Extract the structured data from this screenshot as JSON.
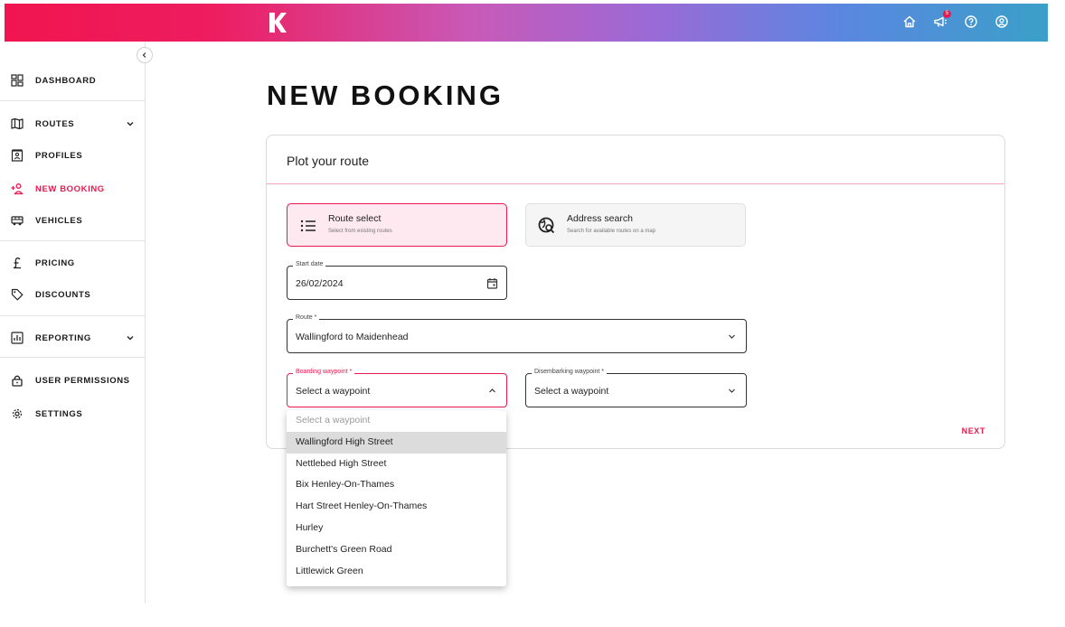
{
  "header": {
    "logo_letter": "K",
    "icons": [
      "home-icon",
      "megaphone-icon",
      "help-icon",
      "account-icon"
    ],
    "notification_count": "5"
  },
  "sidebar": {
    "items": [
      {
        "label": "DASHBOARD",
        "icon": "dashboard-icon"
      },
      {
        "label": "ROUTES",
        "icon": "map-icon"
      },
      {
        "label": "PROFILES",
        "icon": "profile-card-icon"
      },
      {
        "label": "NEW BOOKING",
        "icon": "add-person-icon",
        "active": true
      },
      {
        "label": "VEHICLES",
        "icon": "bus-icon"
      },
      {
        "label": "PRICING",
        "icon": "pound-icon"
      },
      {
        "label": "DISCOUNTS",
        "icon": "tag-icon"
      },
      {
        "label": "REPORTING",
        "icon": "report-icon"
      },
      {
        "label": "USER PERMISSIONS",
        "icon": "lock-icon"
      },
      {
        "label": "SETTINGS",
        "icon": "gear-icon"
      }
    ]
  },
  "page": {
    "title": "NEW BOOKING"
  },
  "card": {
    "title": "Plot your route",
    "options": [
      {
        "title": "Route select",
        "subtitle": "Select from existing routes",
        "selected": true
      },
      {
        "title": "Address search",
        "subtitle": "Search for available routes on a map",
        "selected": false
      }
    ],
    "start_date": {
      "label": "Start date",
      "value": "26/02/2024"
    },
    "route": {
      "label": "Route *",
      "value": "Wallingford to Maidenhead"
    },
    "boarding": {
      "label": "Boarding waypoint *",
      "value": "Select a waypoint"
    },
    "disembarking": {
      "label": "Disembarking waypoint *",
      "value": "Select a waypoint"
    },
    "next_label": "NEXT"
  },
  "dropdown": {
    "options": [
      "Select a waypoint",
      "Wallingford High Street",
      "Nettlebed High Street",
      "Bix Henley-On-Thames",
      "Hart Street Henley-On-Thames",
      "Hurley",
      "Burchett's Green Road",
      "Littlewick Green"
    ],
    "highlighted": "Wallingford High Street"
  },
  "colors": {
    "accent": "#e8194f",
    "selected_bg": "#fde9ef"
  }
}
